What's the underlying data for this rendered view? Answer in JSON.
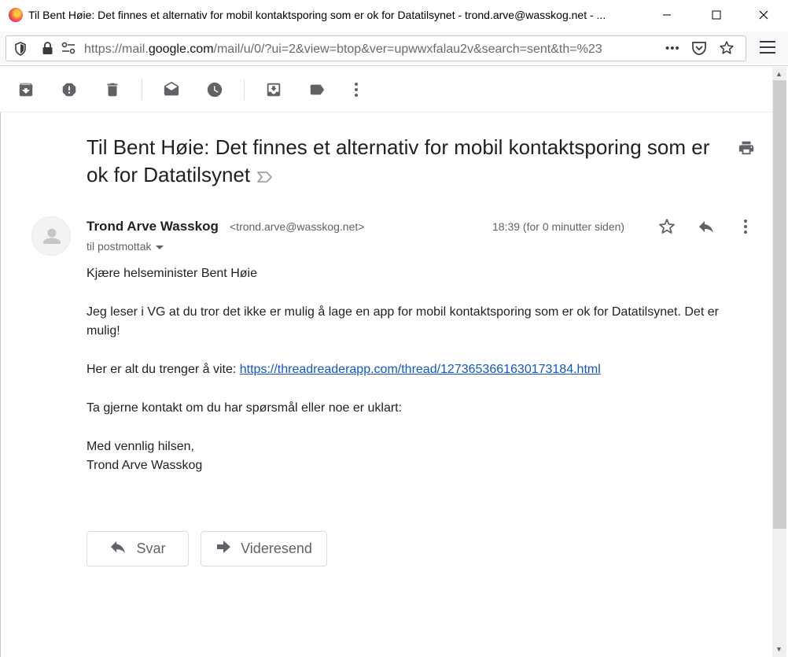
{
  "window": {
    "title": "Til Bent Høie: Det finnes et alternativ for mobil kontaktsporing som er ok for Datatilsynet - trond.arve@wasskog.net - ...",
    "minimize": "─",
    "maximize": "☐",
    "close": "✕"
  },
  "address_bar": {
    "url_prefix": "https://mail.",
    "url_domain": "google.com",
    "url_rest": "/mail/u/0/?ui=2&view=btop&ver=upwwxfalau2v&search=sent&th=%23",
    "more": "•••"
  },
  "toolbar": {
    "items": [
      "archive",
      "report-spam",
      "delete",
      "mark-unread",
      "snooze",
      "move-to",
      "labels",
      "more"
    ]
  },
  "email": {
    "subject": "Til Bent Høie: Det finnes et alternativ for mobil kontaktsporing som er ok for Datatilsynet",
    "sender_name": "Trond Arve Wasskog",
    "sender_email": "<trond.arve@wasskog.net>",
    "recipient": "til postmottak",
    "timestamp": "18:39 (for 0 minutter siden)",
    "body": {
      "greeting": "Kjære helseminister Bent Høie",
      "paragraph1": "Jeg leser i VG at du tror det ikke er mulig å lage en app for mobil kontaktsporing som er ok for Datatilsynet. Det er mulig!",
      "paragraph2_prefix": "Her er alt du trenger å vite: ",
      "link": "https://threadreaderapp.com/thread/1273653661630173184.html",
      "paragraph3": "Ta gjerne kontakt om du har spørsmål eller noe er uklart:",
      "closing": "Med vennlig hilsen,",
      "signature": "Trond Arve Wasskog"
    }
  },
  "actions": {
    "reply": "Svar",
    "forward": "Videresend"
  }
}
